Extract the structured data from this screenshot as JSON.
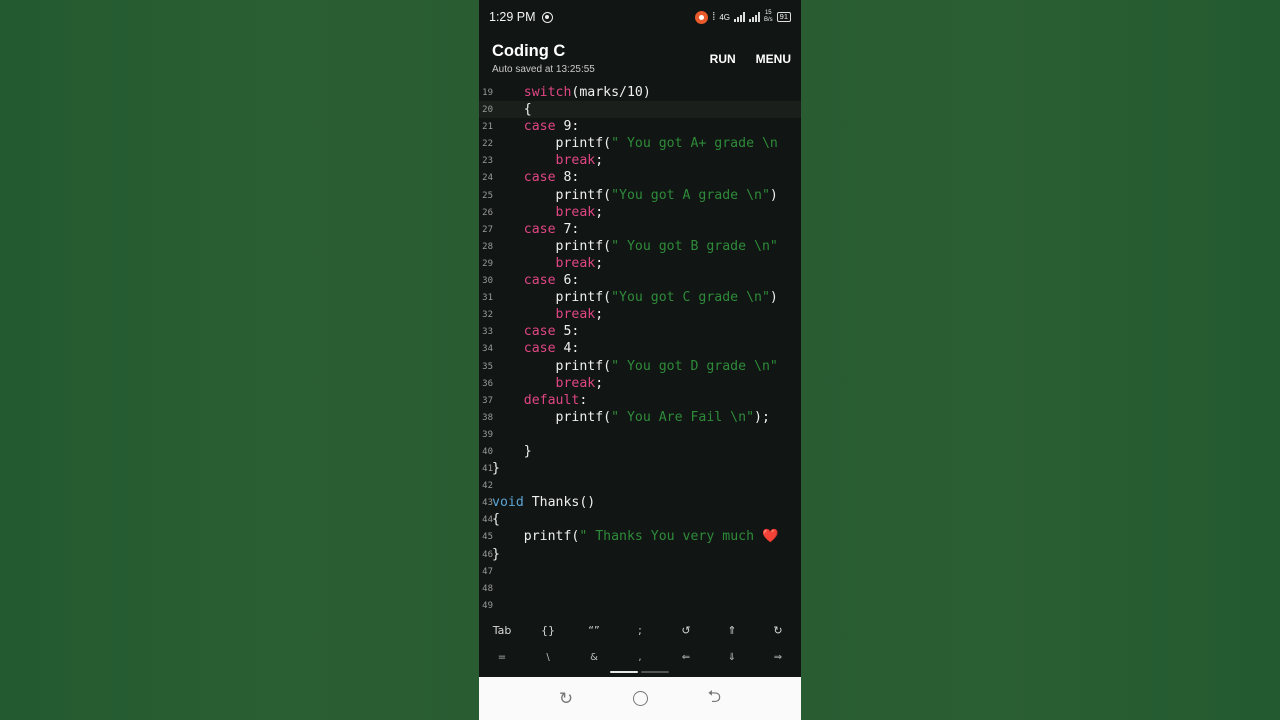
{
  "status": {
    "time": "1:29 PM",
    "net_speed_top": "15",
    "net_speed_unit": "B/s",
    "battery": "91",
    "carrier": "4G"
  },
  "app": {
    "title": "Coding C",
    "subtitle": "Auto saved at 13:25:55",
    "run_label": "RUN",
    "menu_label": "MENU"
  },
  "code_lines": [
    {
      "n": "19",
      "tokens": [
        {
          "t": "    ",
          "c": ""
        },
        {
          "t": "switch",
          "c": "kw"
        },
        {
          "t": "(marks/10)",
          "c": ""
        }
      ]
    },
    {
      "n": "20",
      "tokens": [
        {
          "t": "    {",
          "c": ""
        }
      ],
      "active": true
    },
    {
      "n": "21",
      "tokens": [
        {
          "t": "    ",
          "c": ""
        },
        {
          "t": "case",
          "c": "kw"
        },
        {
          "t": " 9:",
          "c": ""
        }
      ]
    },
    {
      "n": "22",
      "tokens": [
        {
          "t": "        printf(",
          "c": ""
        },
        {
          "t": "\" You got A+ grade \\n",
          "c": "str"
        }
      ]
    },
    {
      "n": "23",
      "tokens": [
        {
          "t": "        ",
          "c": ""
        },
        {
          "t": "break",
          "c": "kw"
        },
        {
          "t": ";",
          "c": ""
        }
      ]
    },
    {
      "n": "24",
      "tokens": [
        {
          "t": "    ",
          "c": ""
        },
        {
          "t": "case",
          "c": "kw"
        },
        {
          "t": " 8:",
          "c": ""
        }
      ]
    },
    {
      "n": "25",
      "tokens": [
        {
          "t": "        printf(",
          "c": ""
        },
        {
          "t": "\"You got A grade \\n\"",
          "c": "str"
        },
        {
          "t": ")",
          "c": ""
        }
      ]
    },
    {
      "n": "26",
      "tokens": [
        {
          "t": "        ",
          "c": ""
        },
        {
          "t": "break",
          "c": "kw"
        },
        {
          "t": ";",
          "c": ""
        }
      ]
    },
    {
      "n": "27",
      "tokens": [
        {
          "t": "    ",
          "c": ""
        },
        {
          "t": "case",
          "c": "kw"
        },
        {
          "t": " 7:",
          "c": ""
        }
      ]
    },
    {
      "n": "28",
      "tokens": [
        {
          "t": "        printf(",
          "c": ""
        },
        {
          "t": "\" You got B grade \\n\"",
          "c": "str"
        }
      ]
    },
    {
      "n": "29",
      "tokens": [
        {
          "t": "        ",
          "c": ""
        },
        {
          "t": "break",
          "c": "kw"
        },
        {
          "t": ";",
          "c": ""
        }
      ]
    },
    {
      "n": "30",
      "tokens": [
        {
          "t": "    ",
          "c": ""
        },
        {
          "t": "case",
          "c": "kw"
        },
        {
          "t": " 6:",
          "c": ""
        }
      ]
    },
    {
      "n": "31",
      "tokens": [
        {
          "t": "        printf(",
          "c": ""
        },
        {
          "t": "\"You got C grade \\n\"",
          "c": "str"
        },
        {
          "t": ")",
          "c": ""
        }
      ]
    },
    {
      "n": "32",
      "tokens": [
        {
          "t": "        ",
          "c": ""
        },
        {
          "t": "break",
          "c": "kw"
        },
        {
          "t": ";",
          "c": ""
        }
      ]
    },
    {
      "n": "33",
      "tokens": [
        {
          "t": "    ",
          "c": ""
        },
        {
          "t": "case",
          "c": "kw"
        },
        {
          "t": " 5:",
          "c": ""
        }
      ]
    },
    {
      "n": "34",
      "tokens": [
        {
          "t": "    ",
          "c": ""
        },
        {
          "t": "case",
          "c": "kw"
        },
        {
          "t": " 4:",
          "c": ""
        }
      ]
    },
    {
      "n": "35",
      "tokens": [
        {
          "t": "        printf(",
          "c": ""
        },
        {
          "t": "\" You got D grade \\n\"",
          "c": "str"
        }
      ]
    },
    {
      "n": "36",
      "tokens": [
        {
          "t": "        ",
          "c": ""
        },
        {
          "t": "break",
          "c": "kw"
        },
        {
          "t": ";",
          "c": ""
        }
      ]
    },
    {
      "n": "37",
      "tokens": [
        {
          "t": "    ",
          "c": ""
        },
        {
          "t": "default",
          "c": "kw"
        },
        {
          "t": ":",
          "c": ""
        }
      ]
    },
    {
      "n": "38",
      "tokens": [
        {
          "t": "        printf(",
          "c": ""
        },
        {
          "t": "\" You Are Fail \\n\"",
          "c": "str"
        },
        {
          "t": ");",
          "c": ""
        }
      ]
    },
    {
      "n": "39",
      "tokens": [
        {
          "t": "",
          "c": ""
        }
      ]
    },
    {
      "n": "40",
      "tokens": [
        {
          "t": "    }",
          "c": ""
        }
      ]
    },
    {
      "n": "41",
      "tokens": [
        {
          "t": "}",
          "c": ""
        }
      ]
    },
    {
      "n": "42",
      "tokens": [
        {
          "t": "",
          "c": ""
        }
      ]
    },
    {
      "n": "43",
      "tokens": [
        {
          "t": "void",
          "c": "kw2"
        },
        {
          "t": " Thanks()",
          "c": ""
        }
      ]
    },
    {
      "n": "44",
      "tokens": [
        {
          "t": "{",
          "c": ""
        }
      ]
    },
    {
      "n": "45",
      "tokens": [
        {
          "t": "    printf(",
          "c": ""
        },
        {
          "t": "\" Thanks You very much ",
          "c": "str"
        },
        {
          "t": "❤️",
          "c": "str"
        }
      ]
    },
    {
      "n": "46",
      "tokens": [
        {
          "t": "}",
          "c": ""
        }
      ]
    },
    {
      "n": "47",
      "tokens": [
        {
          "t": "",
          "c": ""
        }
      ]
    },
    {
      "n": "48",
      "tokens": [
        {
          "t": "",
          "c": ""
        }
      ]
    },
    {
      "n": "49",
      "tokens": [
        {
          "t": "",
          "c": ""
        }
      ]
    }
  ],
  "keys_row1": [
    "Tab",
    "{}",
    "“”",
    ";",
    "↺",
    "⇑",
    "↻"
  ],
  "keys_row2": [
    "=",
    "\\",
    "&",
    ",",
    "⇐",
    "⇓",
    "⇒"
  ],
  "colors": {
    "keyword": "#e04684",
    "type_keyword": "#5ba4d6",
    "string": "#2e8b3a",
    "editor_bg": "#111513",
    "side_bg": "#275a30"
  }
}
